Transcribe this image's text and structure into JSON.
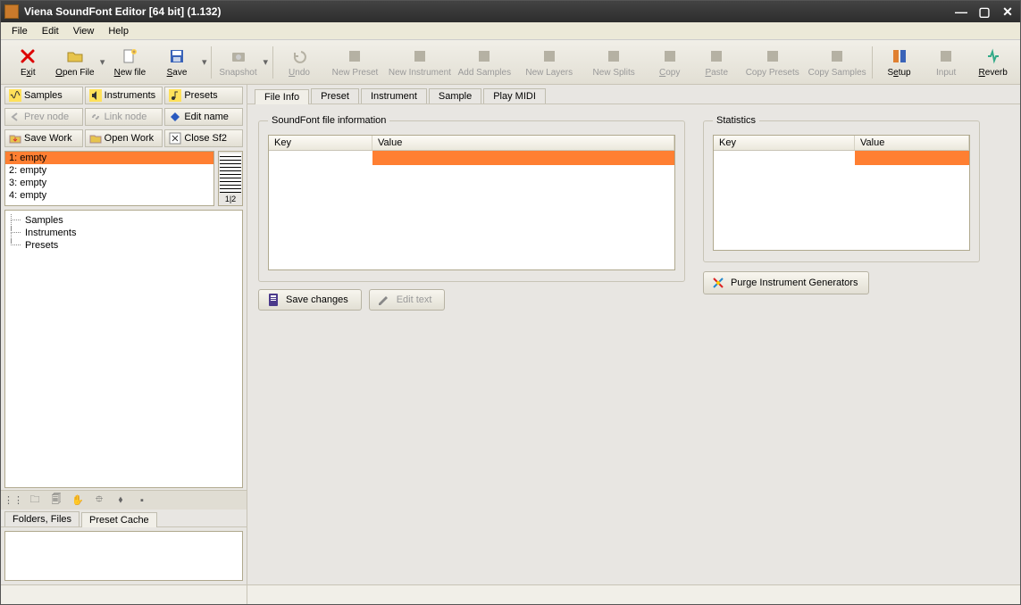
{
  "window": {
    "title": "Viena SoundFont Editor [64 bit] (1.132)"
  },
  "menubar": [
    "File",
    "Edit",
    "View",
    "Help"
  ],
  "toolbar": [
    {
      "label": "Exit",
      "accel": "x",
      "icon": "x-red",
      "enabled": true
    },
    {
      "label": "Open File",
      "accel": "O",
      "icon": "folder-open",
      "enabled": true,
      "drop": true
    },
    {
      "label": "New file",
      "accel": "N",
      "icon": "new-file",
      "enabled": true
    },
    {
      "label": "Save",
      "accel": "S",
      "icon": "save",
      "enabled": true,
      "drop": true
    },
    {
      "sep": true
    },
    {
      "label": "Snapshot",
      "icon": "camera",
      "enabled": false,
      "drop": true
    },
    {
      "sep": true
    },
    {
      "label": "Undo",
      "accel": "U",
      "icon": "undo",
      "enabled": false
    },
    {
      "label": "New Preset",
      "icon": "preset",
      "enabled": false
    },
    {
      "label": "New Instrument",
      "icon": "instrument",
      "enabled": false
    },
    {
      "label": "Add Samples",
      "icon": "samples",
      "enabled": false
    },
    {
      "label": "New Layers",
      "icon": "layers",
      "enabled": false
    },
    {
      "label": "New Splits",
      "icon": "splits",
      "enabled": false
    },
    {
      "label": "Copy",
      "accel": "C",
      "icon": "copy",
      "enabled": false
    },
    {
      "label": "Paste",
      "accel": "P",
      "icon": "paste",
      "enabled": false
    },
    {
      "label": "Copy Presets",
      "icon": "copy-presets",
      "enabled": false
    },
    {
      "label": "Copy Samples",
      "icon": "copy-samples",
      "enabled": false
    },
    {
      "sep": true
    },
    {
      "label": "Setup",
      "accel": "e",
      "icon": "setup",
      "enabled": true
    },
    {
      "label": "Input",
      "icon": "input",
      "enabled": false
    },
    {
      "label": "Reverb",
      "accel": "R",
      "icon": "reverb",
      "enabled": true
    }
  ],
  "sidebar": {
    "catButtons": [
      {
        "label": "Samples",
        "icon": "wave",
        "enabled": true
      },
      {
        "label": "Instruments",
        "icon": "speaker",
        "enabled": true
      },
      {
        "label": "Presets",
        "icon": "note",
        "enabled": true
      }
    ],
    "nodeButtons": [
      {
        "label": "Prev node",
        "icon": "arrow-left",
        "enabled": false
      },
      {
        "label": "Link node",
        "icon": "link",
        "enabled": false
      },
      {
        "label": "Edit name",
        "icon": "edit-blue",
        "enabled": true
      }
    ],
    "workButtons": [
      {
        "label": "Save Work",
        "icon": "folder-save",
        "enabled": true
      },
      {
        "label": "Open Work",
        "icon": "folder-open-y",
        "enabled": true
      },
      {
        "label": "Close Sf2",
        "icon": "close-x",
        "enabled": true
      }
    ],
    "fileList": [
      "1: empty",
      "2: empty",
      "3: empty",
      "4: empty"
    ],
    "fileListSelected": 0,
    "miniKbdLabel": "1|2",
    "tree": [
      "Samples",
      "Instruments",
      "Presets"
    ],
    "bottomTabs": [
      "Folders, Files",
      "Preset Cache"
    ],
    "bottomTabActive": 1
  },
  "main": {
    "tabs": [
      "File Info",
      "Preset",
      "Instrument",
      "Sample",
      "Play MIDI"
    ],
    "activeTab": 0,
    "fileInfo": {
      "groupLabel": "SoundFont file information",
      "columns": [
        "Key",
        "Value"
      ],
      "keyColW": 116,
      "saveBtn": "Save changes",
      "editBtn": "Edit text"
    },
    "stats": {
      "groupLabel": "Statistics",
      "columns": [
        "Key",
        "Value"
      ],
      "keyColW": 158
    },
    "purgeBtn": "Purge Instrument Generators"
  }
}
